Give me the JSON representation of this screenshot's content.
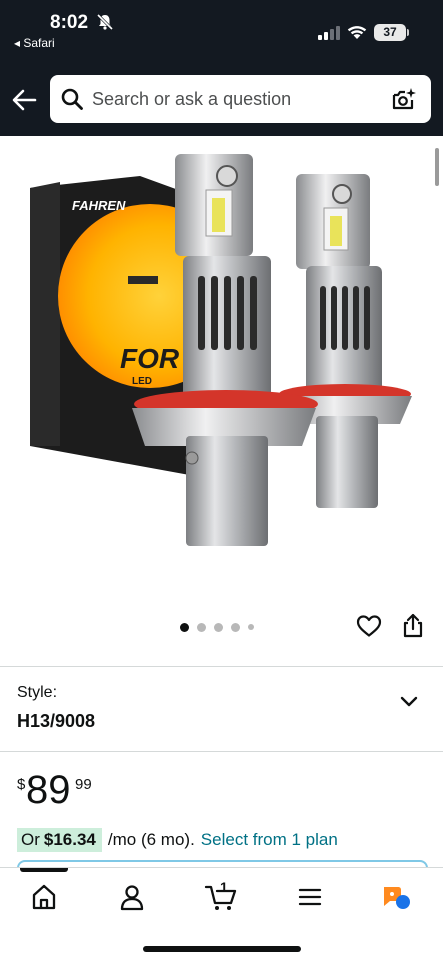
{
  "status_bar": {
    "time": "8:02",
    "back_app": "◂ Safari",
    "battery": "37"
  },
  "header": {
    "search_placeholder": "Search or ask a question"
  },
  "product": {
    "image_brand": "FAHREN",
    "image_box_text": "FOR",
    "image_box_subtext": "LED",
    "image_count": 5,
    "active_image_index": 0
  },
  "style": {
    "label": "Style:",
    "value": "H13/9008"
  },
  "price": {
    "symbol": "$",
    "whole": "89",
    "fraction": "99"
  },
  "plan": {
    "prefix": "Or",
    "amount": "$16.34",
    "term": "/mo (6 mo).",
    "link": "Select from 1 plan"
  },
  "tabbar": {
    "cart_count": "1",
    "items": [
      "home-icon",
      "account-icon",
      "cart-icon",
      "menu-icon",
      "rufus-icon"
    ]
  },
  "colors": {
    "header_bg": "#131921",
    "link": "#007185",
    "plan_highlight": "#cdeedb",
    "rufus_orange": "#ff8a1f",
    "rufus_blue": "#1a73e8"
  }
}
